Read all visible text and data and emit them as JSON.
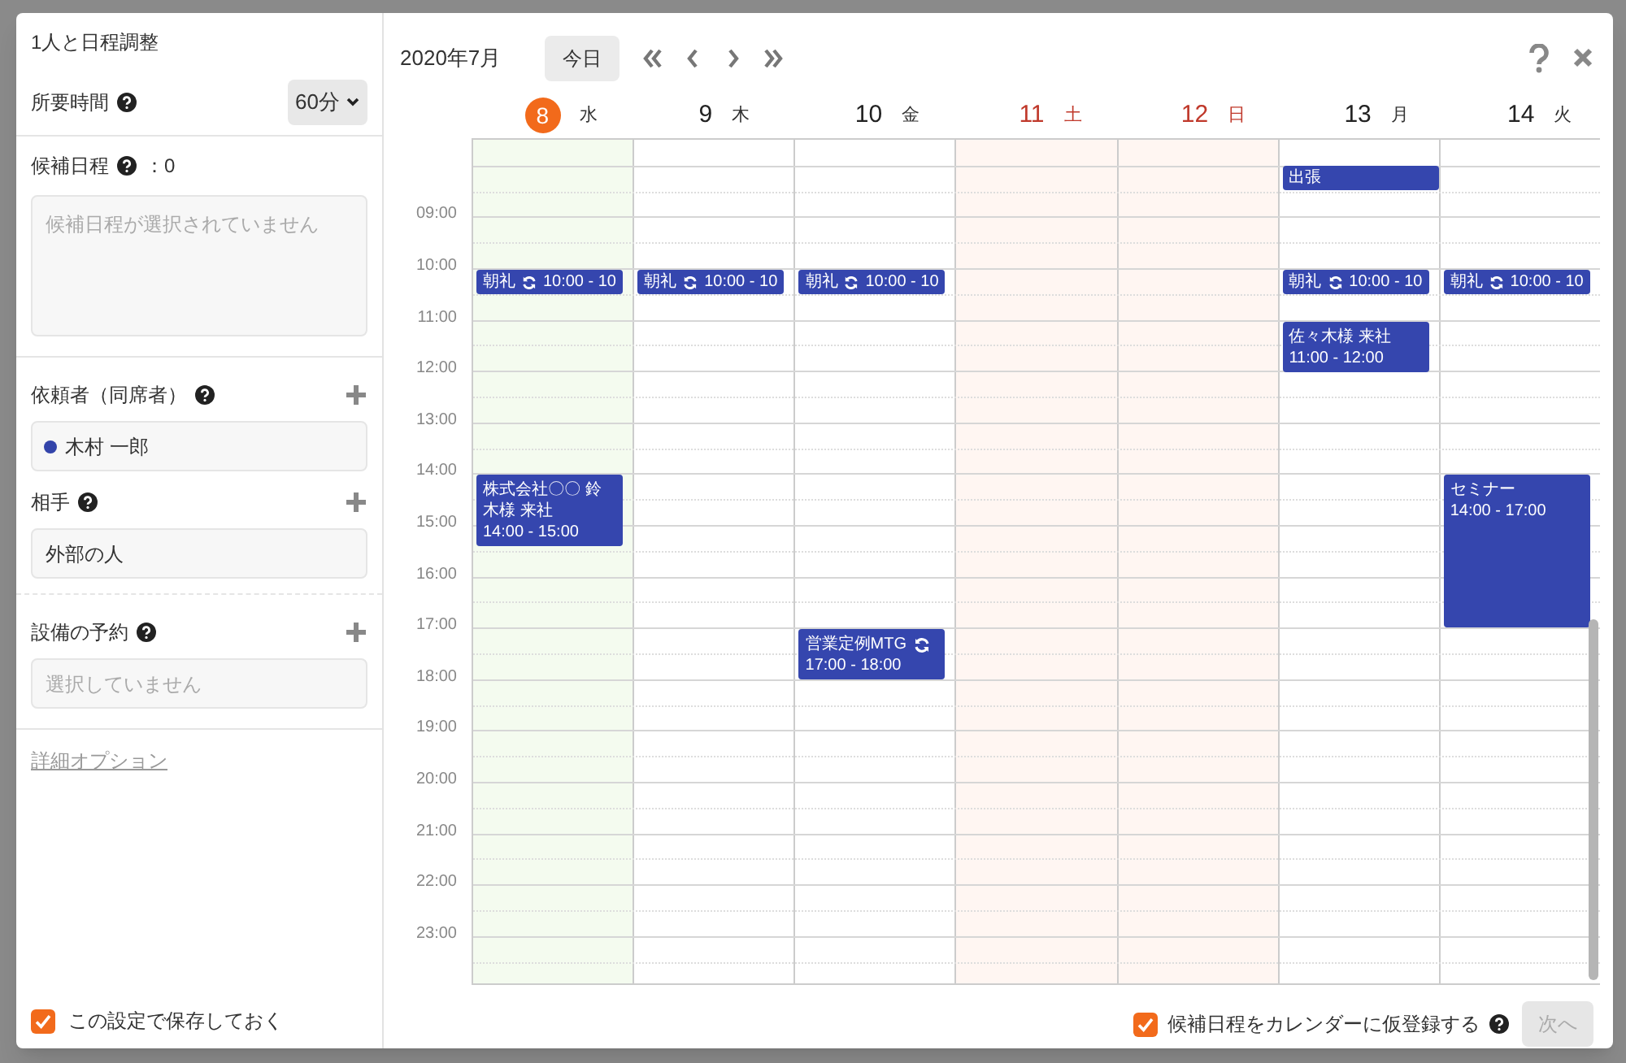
{
  "dialog": {
    "title": "1人と日程調整"
  },
  "duration": {
    "label": "所要時間",
    "value": "60分"
  },
  "candidates": {
    "label": "候補日程",
    "count": "：0",
    "placeholder": "候補日程が選択されていません"
  },
  "requesters": {
    "label": "依頼者（同席者）",
    "items": [
      {
        "name": "木村 一郎",
        "color": "#3344aa"
      }
    ]
  },
  "partner": {
    "label": "相手",
    "value": "外部の人"
  },
  "facility": {
    "label": "設備の予約",
    "placeholder": "選択していません"
  },
  "advanced_link": "詳細オプション",
  "save_setting": {
    "label": "この設定で保存しておく",
    "checked": true
  },
  "calendar": {
    "month": "2020年7月",
    "today_button": "今日",
    "hours": [
      "09:00",
      "10:00",
      "11:00",
      "12:00",
      "13:00",
      "14:00",
      "15:00",
      "16:00",
      "17:00",
      "18:00",
      "19:00",
      "20:00",
      "21:00",
      "22:00",
      "23:00"
    ],
    "days": [
      {
        "date": "8",
        "weekday": "水",
        "kind": "today",
        "events": [
          {
            "kind": "brief",
            "title": "朝礼",
            "time": "10:00 - 10",
            "recurring": true
          },
          {
            "kind": "block",
            "title": "株式会社〇〇 鈴木様 来社",
            "time": "14:00 - 15:00",
            "recurring": false
          }
        ]
      },
      {
        "date": "9",
        "weekday": "木",
        "kind": "weekday",
        "events": [
          {
            "kind": "brief",
            "title": "朝礼",
            "time": "10:00 - 10",
            "recurring": true
          }
        ]
      },
      {
        "date": "10",
        "weekday": "金",
        "kind": "weekday",
        "events": [
          {
            "kind": "brief",
            "title": "朝礼",
            "time": "10:00 - 10",
            "recurring": true
          },
          {
            "kind": "block",
            "title": "営業定例MTG",
            "time": "17:00 - 18:00",
            "recurring": true
          }
        ]
      },
      {
        "date": "11",
        "weekday": "土",
        "kind": "holiday"
      },
      {
        "date": "12",
        "weekday": "日",
        "kind": "holiday"
      },
      {
        "date": "13",
        "weekday": "月",
        "kind": "weekday",
        "events": [
          {
            "kind": "allday",
            "title": "出張",
            "recurring": false
          },
          {
            "kind": "brief",
            "title": "朝礼",
            "time": "10:00 - 10",
            "recurring": true
          },
          {
            "kind": "block",
            "title": "佐々木様 来社",
            "time": "11:00 - 12:00",
            "recurring": false
          }
        ]
      },
      {
        "date": "14",
        "weekday": "火",
        "kind": "weekday",
        "events": [
          {
            "kind": "brief",
            "title": "朝礼",
            "time": "10:00 - 10",
            "recurring": true
          },
          {
            "kind": "block",
            "title": "セミナー",
            "time": "14:00 - 17:00",
            "recurring": false
          }
        ]
      }
    ]
  },
  "register": {
    "label": "候補日程をカレンダーに仮登録する",
    "checked": true
  },
  "next_button": {
    "label": "次へ",
    "disabled": true
  }
}
